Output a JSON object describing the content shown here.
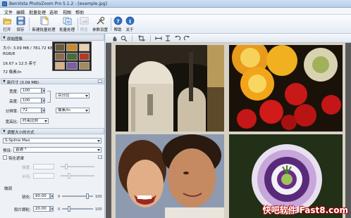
{
  "window": {
    "title": "BenVista PhotoZoom Pro 5.1.2 - [example.jpg]"
  },
  "menu": [
    "文件",
    "编辑",
    "批量处理",
    "选项",
    "视图",
    "帮助"
  ],
  "toolbar": {
    "open": "打开",
    "save": "保存",
    "new_batch": "新建批量处理",
    "batch": "批量处理",
    "preview": "预览",
    "param_settings": "参数设置",
    "help": "帮助",
    "about": "关于"
  },
  "source_panel": {
    "header": "原始图像",
    "size": "大小: 3.09 MB / 781.72 KB",
    "mode": "RGB/8",
    "dimensions": "16.67 x 12.5 英寸",
    "resolution": "72 像素/in"
  },
  "new_size_panel": {
    "header": "新尺寸 (3.09 MB)",
    "width_label": "宽度:",
    "width_value": "100",
    "height_label": "高度:",
    "height_value": "100",
    "unit_percent": "百分比",
    "resolution_label": "分辨率:",
    "resolution_value": "72",
    "unit_resolution": "像素/in",
    "aspect_label": "宽高比:",
    "aspect_value": "约束比例"
  },
  "resize_panel": {
    "header": "调整大小的方式",
    "method": "S-Spline Max",
    "preset_label": "预设:",
    "preset_value": "普通 *",
    "unsharp_label": "钝化遮罩",
    "strength_label": "强度:",
    "radius_label": "半径:",
    "fine_tune_label": "微调",
    "sharpness_label": "锐化:",
    "sharpness_value": "90.00",
    "sharpness_level": 0.9,
    "film_grain_label": "胶片颗粒:",
    "film_grain_value": "20.00",
    "film_grain_level": 0.2,
    "range_min": "0",
    "range_max": "100"
  },
  "image_toolbar": {
    "icons": [
      "hand-icon",
      "zoom-icon",
      "crop-icon",
      "fit-width-icon",
      "fit-height-icon",
      "rotate-left-icon",
      "rotate-right-icon"
    ]
  },
  "watermark": "快吧软件 Fast8.com",
  "colors": {
    "accent": "#3d78c8",
    "watermark_outline": "#b00000"
  }
}
